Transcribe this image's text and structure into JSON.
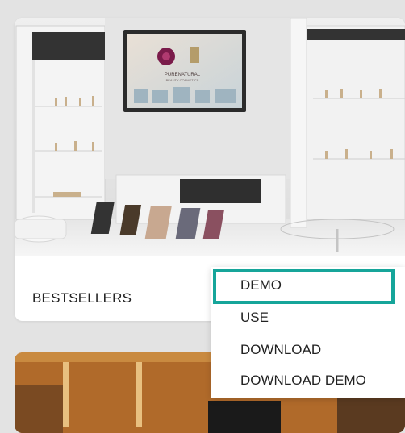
{
  "cards": [
    {
      "title": "BESTSELLERS",
      "image_sign_lines": [
        "PURENATURAL",
        "BEAUTY COSMETICS"
      ]
    }
  ],
  "menu": {
    "items": [
      {
        "label": "DEMO"
      },
      {
        "label": "USE"
      },
      {
        "label": "DOWNLOAD"
      },
      {
        "label": "DOWNLOAD DEMO"
      }
    ]
  },
  "colors": {
    "highlight": "#16a59a"
  }
}
